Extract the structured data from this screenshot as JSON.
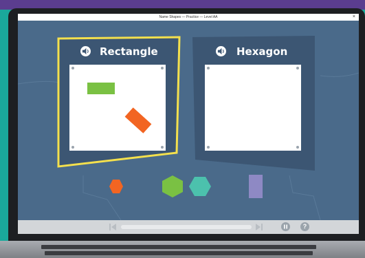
{
  "window": {
    "title": "Name Shapes — Practice — Level AA",
    "close_symbol": "×"
  },
  "cards": [
    {
      "label": "Rectangle",
      "highlighted": true,
      "speaker_icon": "speaker-icon"
    },
    {
      "label": "Hexagon",
      "highlighted": false,
      "speaker_icon": "speaker-icon"
    }
  ],
  "placed_shapes": [
    {
      "card": "Rectangle",
      "shape": "rectangle",
      "color": "#7ac143"
    },
    {
      "card": "Rectangle",
      "shape": "rectangle",
      "color": "#f26522"
    }
  ],
  "tray_shapes": [
    {
      "shape": "hexagon",
      "color": "#f26522"
    },
    {
      "shape": "hexagon",
      "color": "#7ac143"
    },
    {
      "shape": "hexagon",
      "color": "#4cc1ad"
    },
    {
      "shape": "rectangle",
      "color": "#8e89c4"
    }
  ],
  "controls": {
    "rewind_icon": "skip-back-icon",
    "forward_icon": "skip-forward-icon",
    "pause_icon": "pause-icon",
    "help_label": "?"
  },
  "colors": {
    "screen_bg": "#4a6a8a",
    "card_bg": "#3c5673",
    "highlight": "#f4e04d",
    "brand_purple": "#5b3d8f",
    "brand_teal": "#1aa89b"
  }
}
